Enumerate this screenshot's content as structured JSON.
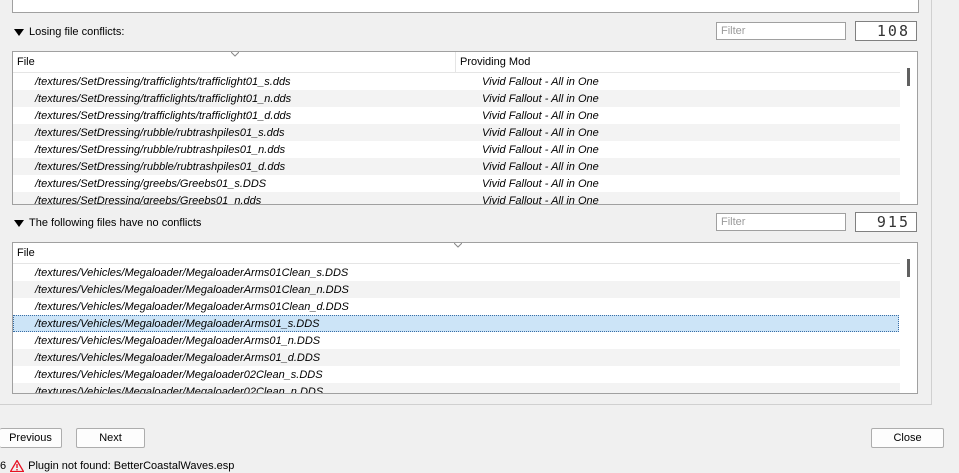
{
  "losing": {
    "title": "Losing file conflicts:",
    "filter_placeholder": "Filter",
    "count": "108",
    "columns": [
      "File",
      "Providing Mod"
    ],
    "rows": [
      {
        "file": "/textures/SetDressing/trafficlights/trafficlight01_s.dds",
        "mod": "Vivid Fallout - All in One"
      },
      {
        "file": "/textures/SetDressing/trafficlights/trafficlight01_n.dds",
        "mod": "Vivid Fallout - All in One"
      },
      {
        "file": "/textures/SetDressing/trafficlights/trafficlight01_d.dds",
        "mod": "Vivid Fallout - All in One"
      },
      {
        "file": "/textures/SetDressing/rubble/rubtrashpiles01_s.dds",
        "mod": "Vivid Fallout - All in One"
      },
      {
        "file": "/textures/SetDressing/rubble/rubtrashpiles01_n.dds",
        "mod": "Vivid Fallout - All in One"
      },
      {
        "file": "/textures/SetDressing/rubble/rubtrashpiles01_d.dds",
        "mod": "Vivid Fallout - All in One"
      },
      {
        "file": "/textures/SetDressing/greebs/Greebs01_s.DDS",
        "mod": "Vivid Fallout - All in One"
      },
      {
        "file": "/textures/SetDressing/greebs/Greebs01_n.dds",
        "mod": "Vivid Fallout - All in One"
      }
    ]
  },
  "noconflict": {
    "title": "The following files have no conflicts",
    "filter_placeholder": "Filter",
    "count": "915",
    "columns": [
      "File"
    ],
    "rows": [
      "/textures/Vehicles/Megaloader/MegaloaderArms01Clean_s.DDS",
      "/textures/Vehicles/Megaloader/MegaloaderArms01Clean_n.DDS",
      "/textures/Vehicles/Megaloader/MegaloaderArms01Clean_d.DDS",
      "/textures/Vehicles/Megaloader/MegaloaderArms01_s.DDS",
      "/textures/Vehicles/Megaloader/MegaloaderArms01_n.DDS",
      "/textures/Vehicles/Megaloader/MegaloaderArms01_d.DDS",
      "/textures/Vehicles/Megaloader/Megaloader02Clean_s.DDS",
      "/textures/Vehicles/Megaloader/Megaloader02Clean_n.DDS"
    ],
    "selected_index": 3
  },
  "buttons": {
    "previous": "Previous",
    "next": "Next",
    "close": "Close"
  },
  "status": {
    "prefix": "6",
    "icon": "warning-icon",
    "message": "Plugin not found: BetterCoastalWaves.esp"
  },
  "colors": {
    "selection": "#cce4f7",
    "warning": "#e81123"
  }
}
